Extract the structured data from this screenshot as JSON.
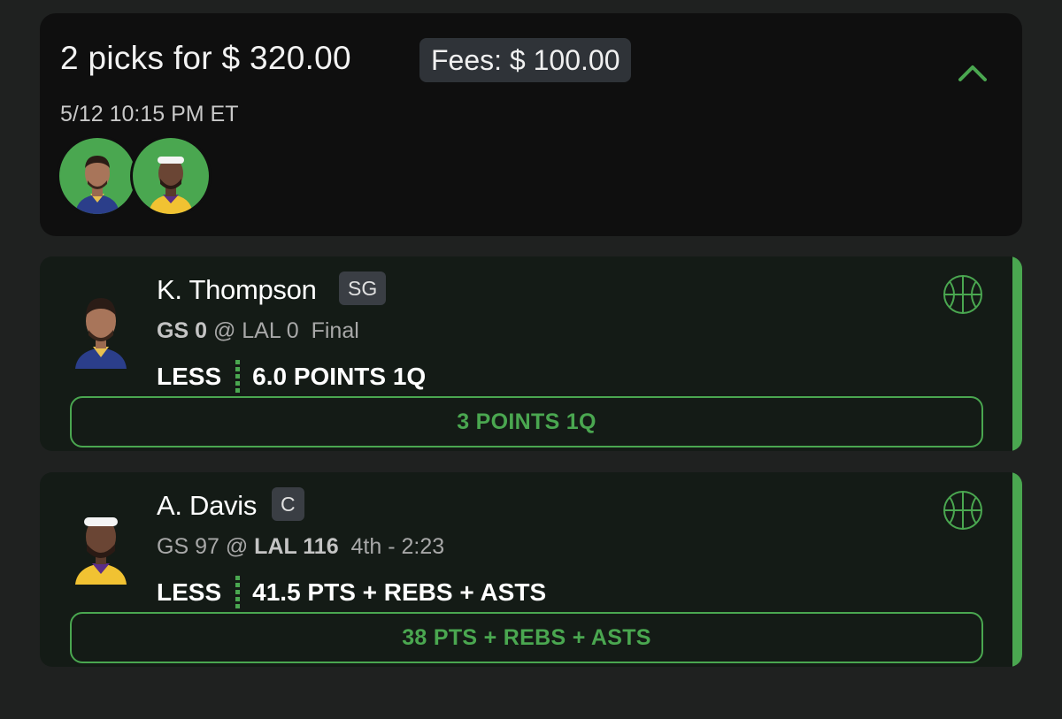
{
  "entry": {
    "title": "2 picks for $ 320.00",
    "fees": "Fees: $ 100.00",
    "datetime": "5/12 10:15 PM ET",
    "collapse_icon": "chevron-up-icon",
    "avatar_bg": "#4aa750"
  },
  "picks": [
    {
      "player": "K. Thompson",
      "position": "SG",
      "away_team": "GS 0",
      "at": "@",
      "home_team": "LAL 0",
      "status": "Final",
      "bold_side": "away",
      "direction": "LESS",
      "projection": "6.0 POINTS 1Q",
      "result": "3 POINTS 1Q",
      "sport_icon": "basketball-icon"
    },
    {
      "player": "A. Davis",
      "position": "C",
      "away_team": "GS 97",
      "at": "@",
      "home_team": "LAL 116",
      "status": "4th - 2:23",
      "bold_side": "home",
      "direction": "LESS",
      "projection": "41.5 PTS + REBS + ASTS",
      "result": "38 PTS + REBS + ASTS",
      "sport_icon": "basketball-icon"
    }
  ],
  "colors": {
    "accent": "#4aa750",
    "card": "#141b16",
    "summary": "#0f0f0f",
    "background": "#1f2120"
  }
}
